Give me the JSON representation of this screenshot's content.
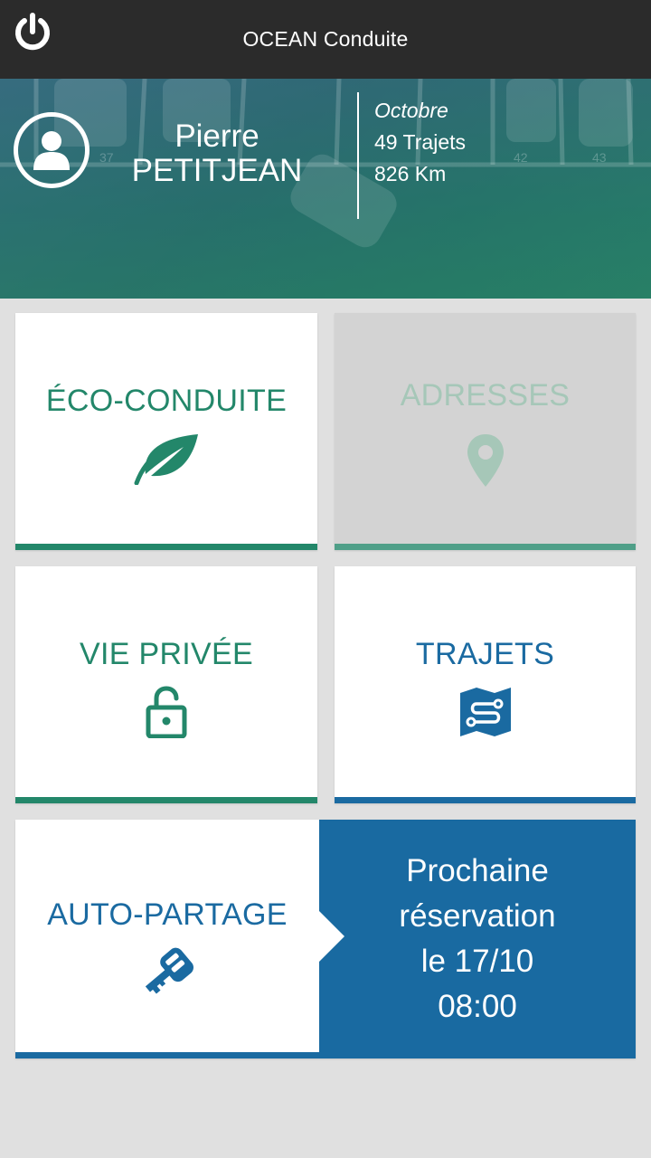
{
  "app": {
    "title": "OCEAN Conduite",
    "power_icon": "power-icon"
  },
  "user": {
    "first_name": "Pierre",
    "last_name": "PETITJEAN",
    "avatar_icon": "user-icon"
  },
  "stats": {
    "month": "Octobre",
    "trips": "49 Trajets",
    "distance": "826 Km"
  },
  "tiles": {
    "eco": {
      "label": "ÉCO-CONDUITE",
      "icon": "leaf-icon"
    },
    "adresses": {
      "label": "ADRESSES",
      "icon": "map-pin-icon"
    },
    "vie_privee": {
      "label": "VIE PRIVÉE",
      "icon": "unlock-icon"
    },
    "trajets": {
      "label": "TRAJETS",
      "icon": "route-map-icon"
    },
    "auto_partage": {
      "label": "AUTO-PARTAGE",
      "icon": "car-key-icon",
      "reservation_line1": "Prochaine",
      "reservation_line2": "réservation",
      "reservation_line3": "le 17/10",
      "reservation_line4": "08:00"
    }
  },
  "colors": {
    "green": "#23876a",
    "blue": "#1a6aa1",
    "topbar": "#2b2b2b",
    "background": "#e0e0e0"
  }
}
